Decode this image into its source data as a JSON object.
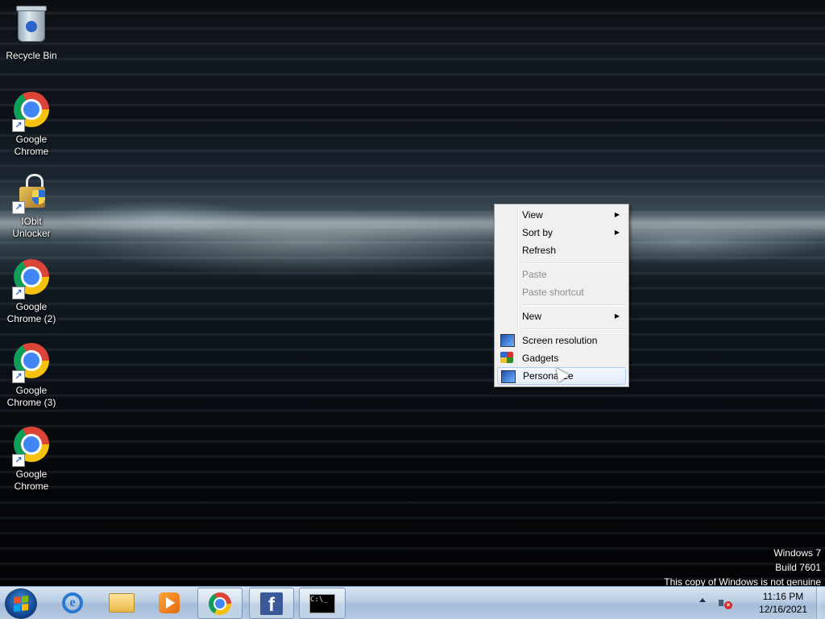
{
  "desktop": {
    "icons": [
      {
        "label": "Recycle Bin",
        "icon": "recycle-bin-icon"
      },
      {
        "label": "Google\nChrome",
        "icon": "chrome-icon"
      },
      {
        "label": "IObit\nUnlocker",
        "icon": "iobit-unlocker-icon"
      },
      {
        "label": "Google\nChrome (2)",
        "icon": "chrome-icon"
      },
      {
        "label": "Google\nChrome (3)",
        "icon": "chrome-icon"
      },
      {
        "label": "Google\nChrome",
        "icon": "chrome-icon"
      }
    ],
    "watermark": {
      "line1": "Windows 7",
      "line2": "Build 7601",
      "line3": "This copy of Windows is not genuine"
    }
  },
  "context_menu": {
    "items": [
      {
        "label": "View",
        "submenu": true,
        "enabled": true
      },
      {
        "label": "Sort by",
        "submenu": true,
        "enabled": true
      },
      {
        "label": "Refresh",
        "submenu": false,
        "enabled": true
      },
      {
        "label": "Paste",
        "submenu": false,
        "enabled": false
      },
      {
        "label": "Paste shortcut",
        "submenu": false,
        "enabled": false
      },
      {
        "label": "New",
        "submenu": true,
        "enabled": true
      },
      {
        "label": "Screen resolution",
        "icon": "monitor-icon",
        "enabled": true
      },
      {
        "label": "Gadgets",
        "icon": "gadgets-icon",
        "enabled": true
      },
      {
        "label": "Personalize",
        "icon": "personalize-icon",
        "enabled": true,
        "highlighted": true
      }
    ]
  },
  "taskbar": {
    "pinned": [
      {
        "name": "internet-explorer",
        "icon": "ie-icon"
      },
      {
        "name": "windows-explorer",
        "icon": "folder-icon"
      },
      {
        "name": "windows-media-player",
        "icon": "media-player-icon"
      },
      {
        "name": "google-chrome",
        "icon": "chrome-icon",
        "active": true
      },
      {
        "name": "facebook",
        "icon": "facebook-icon",
        "active": true
      },
      {
        "name": "command-prompt",
        "icon": "cmd-icon",
        "active": true
      }
    ],
    "cmd_text": "C:\\_",
    "clock": {
      "time": "11:16 PM",
      "date": "12/16/2021"
    },
    "colors": {
      "taskbar": "#b9cde3",
      "menu_bg": "#f0f0f0",
      "highlight": "#e2ecf9"
    }
  }
}
